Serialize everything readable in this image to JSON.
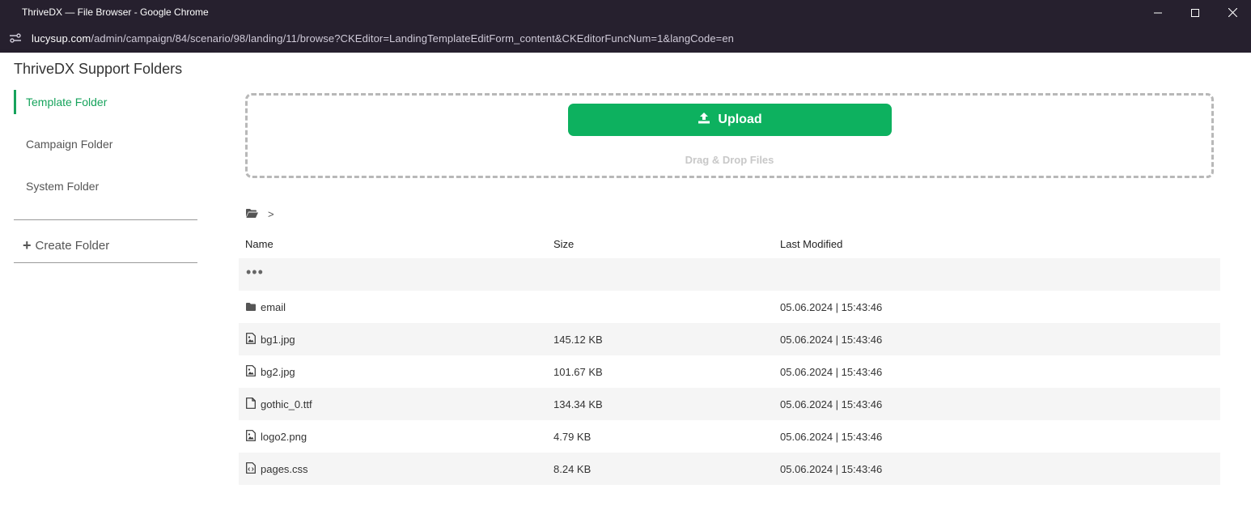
{
  "window": {
    "title": "ThriveDX — File Browser - Google Chrome",
    "url_host": "lucysup.com",
    "url_path": "/admin/campaign/84/scenario/98/landing/11/browse?CKEditor=LandingTemplateEditForm_content&CKEditorFuncNum=1&langCode=en"
  },
  "sidebar": {
    "title": "ThriveDX Support Folders",
    "folders": [
      {
        "label": "Template Folder",
        "active": true
      },
      {
        "label": "Campaign Folder",
        "active": false
      },
      {
        "label": "System Folder",
        "active": false
      }
    ],
    "create_folder_label": "Create Folder"
  },
  "upload": {
    "button_label": "Upload",
    "drag_text": "Drag & Drop Files"
  },
  "breadcrumb": {
    "separator": ">"
  },
  "table": {
    "headers": {
      "name": "Name",
      "size": "Size",
      "modified": "Last Modified"
    },
    "parent_row": "•••",
    "rows": [
      {
        "name": "email",
        "size": "",
        "modified": "05.06.2024 | 15:43:46",
        "icon": "folder-icon"
      },
      {
        "name": "bg1.jpg",
        "size": "145.12 KB",
        "modified": "05.06.2024 | 15:43:46",
        "icon": "image-file-icon"
      },
      {
        "name": "bg2.jpg",
        "size": "101.67 KB",
        "modified": "05.06.2024 | 15:43:46",
        "icon": "image-file-icon"
      },
      {
        "name": "gothic_0.ttf",
        "size": "134.34 KB",
        "modified": "05.06.2024 | 15:43:46",
        "icon": "file-icon"
      },
      {
        "name": "logo2.png",
        "size": "4.79 KB",
        "modified": "05.06.2024 | 15:43:46",
        "icon": "image-file-icon"
      },
      {
        "name": "pages.css",
        "size": "8.24 KB",
        "modified": "05.06.2024 | 15:43:46",
        "icon": "code-file-icon"
      }
    ]
  },
  "colors": {
    "accent": "#0db15f",
    "chrome_bg": "#26202e"
  }
}
